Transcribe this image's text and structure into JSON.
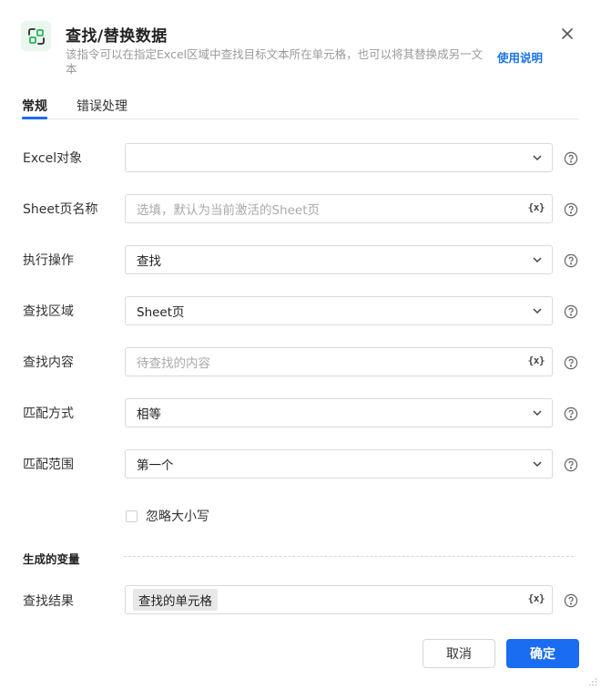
{
  "dialog": {
    "title": "查找/替换数据",
    "description": "该指令可以在指定Excel区域中查找目标文本所在单元格，也可以将其替换成另一文本",
    "help_link": "使用说明",
    "accent_color": "#1a6cf0",
    "icon": "find-replace-icon"
  },
  "tabs": [
    {
      "label": "常规",
      "active": true
    },
    {
      "label": "错误处理",
      "active": false
    }
  ],
  "fields": [
    {
      "label": "Excel对象",
      "value": "",
      "placeholder": "",
      "kind": "select"
    },
    {
      "label": "Sheet页名称",
      "value": "",
      "placeholder": "选填，默认为当前激活的Sheet页",
      "kind": "variable-input"
    },
    {
      "label": "执行操作",
      "value": "查找",
      "placeholder": "",
      "kind": "select"
    },
    {
      "label": "查找区域",
      "value": "Sheet页",
      "placeholder": "",
      "kind": "select"
    },
    {
      "label": "查找内容",
      "value": "",
      "placeholder": "待查找的内容",
      "kind": "variable-input"
    },
    {
      "label": "匹配方式",
      "value": "相等",
      "placeholder": "",
      "kind": "select"
    },
    {
      "label": "匹配范围",
      "value": "第一个",
      "placeholder": "",
      "kind": "select"
    }
  ],
  "variable_button": "{x}",
  "checkbox": {
    "label": "忽略大小写",
    "checked": false
  },
  "output_section": {
    "title": "生成的变量",
    "label": "查找结果",
    "value": "查找的单元格"
  },
  "buttons": {
    "cancel": "取消",
    "ok": "确定"
  }
}
